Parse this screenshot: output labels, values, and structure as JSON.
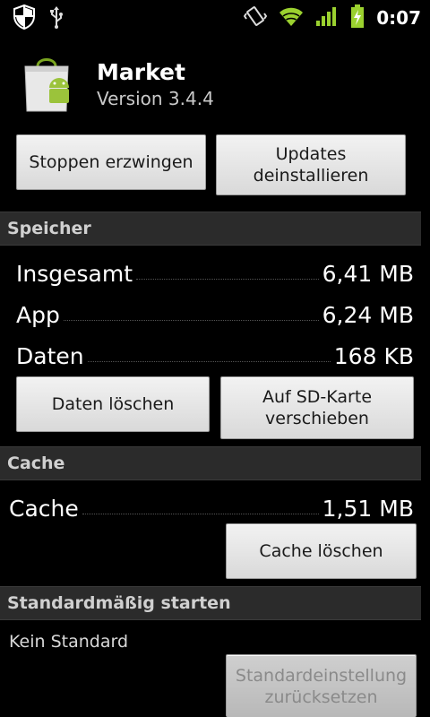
{
  "status_bar": {
    "time": "0:07",
    "icons": [
      "shield-icon",
      "usb-icon",
      "vibrate-icon",
      "wifi-icon",
      "signal-icon",
      "battery-charging-icon"
    ],
    "accent_color": "#9bd12f"
  },
  "app": {
    "name": "Market",
    "version": "Version 3.4.4",
    "icon": "market-bag-icon"
  },
  "actions": {
    "force_stop": "Stoppen erzwingen",
    "uninstall_updates_line1": "Updates",
    "uninstall_updates_line2": "deinstallieren"
  },
  "storage": {
    "header": "Speicher",
    "rows": [
      {
        "label": "Insgesamt",
        "value": "6,41 MB"
      },
      {
        "label": "App",
        "value": "6,24 MB"
      },
      {
        "label": "Daten",
        "value": "168 KB"
      }
    ],
    "clear_data": "Daten löschen",
    "move_sd_line1": "Auf SD-Karte",
    "move_sd_line2": "verschieben"
  },
  "cache": {
    "header": "Cache",
    "label": "Cache",
    "value": "1,51 MB",
    "clear_cache": "Cache löschen"
  },
  "launch_default": {
    "header": "Standardmäßig starten",
    "text": "Kein Standard",
    "clear_defaults_line1": "Standardeinstellung",
    "clear_defaults_line2": "zurücksetzen"
  }
}
